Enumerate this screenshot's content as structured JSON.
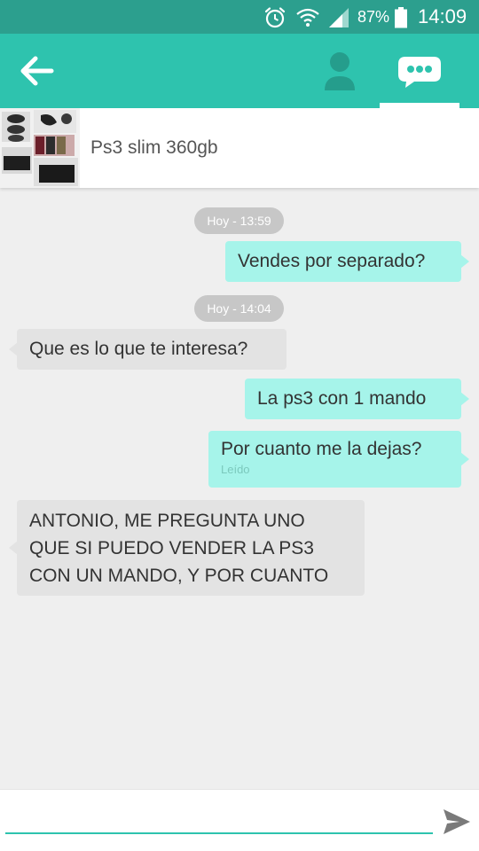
{
  "status_bar": {
    "battery": "87%",
    "time": "14:09",
    "icons": [
      "alarm-icon",
      "wifi-icon",
      "signal-icon",
      "battery-icon"
    ]
  },
  "app_bar": {
    "icons": [
      "back-arrow-icon",
      "profile-icon",
      "chat-icon"
    ],
    "active_tab": "chat"
  },
  "product": {
    "title": "Ps3 slim 360gb"
  },
  "conversation": {
    "date_1": "Hoy - 13:59",
    "date_2": "Hoy - 14:04",
    "msg_1": "Vendes por separado?",
    "msg_2": "Que es lo que te interesa?",
    "msg_3": "La ps3 con 1 mando",
    "msg_4": "Por cuanto me la dejas?",
    "msg_4_status": "Leído",
    "msg_5_line_1": "ANTONIO, ME PREGUNTA UNO",
    "msg_5_line_2": "QUE SI PUEDO VENDER LA PS3",
    "msg_5_line_3": "CON UN MANDO, Y POR CUANTO"
  },
  "composer": {
    "value": "",
    "send_icon": "send-icon"
  },
  "colors": {
    "status_bar": "#2c9f8e",
    "app_bar": "#2ec3ae",
    "outgoing_bubble": "#a6f4ea",
    "incoming_bubble": "#e3e3e3",
    "background": "#efefef"
  }
}
